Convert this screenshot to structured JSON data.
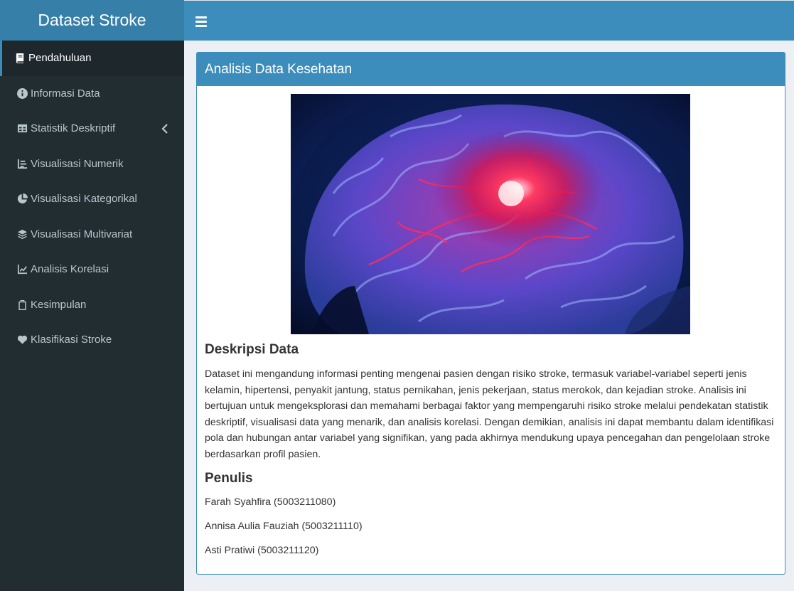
{
  "app": {
    "brand": "Dataset Stroke",
    "toggle_icon": "hamburger-icon"
  },
  "sidebar": {
    "items": [
      {
        "label": "Pendahuluan",
        "icon": "book-icon",
        "active": true
      },
      {
        "label": "Informasi Data",
        "icon": "info-circle-icon"
      },
      {
        "label": "Statistik Deskriptif",
        "icon": "table-icon",
        "has_submenu": true
      },
      {
        "label": "Visualisasi Numerik",
        "icon": "bar-chart-icon"
      },
      {
        "label": "Visualisasi Kategorikal",
        "icon": "pie-chart-icon"
      },
      {
        "label": "Visualisasi Multivariat",
        "icon": "layers-icon"
      },
      {
        "label": "Analisis Korelasi",
        "icon": "line-chart-icon"
      },
      {
        "label": "Kesimpulan",
        "icon": "clipboard-icon"
      },
      {
        "label": "Klasifikasi Stroke",
        "icon": "heartbeat-icon"
      }
    ]
  },
  "main": {
    "box_title": "Analisis Data Kesehatan",
    "image_alt": "brain-illustration",
    "description_title": "Deskripsi Data",
    "description_text": "Dataset ini mengandung informasi penting mengenai pasien dengan risiko stroke, termasuk variabel-variabel seperti jenis kelamin, hipertensi, penyakit jantung, status pernikahan, jenis pekerjaan, status merokok, dan kejadian stroke. Analisis ini bertujuan untuk mengeksplorasi dan memahami berbagai faktor yang mempengaruhi risiko stroke melalui pendekatan statistik deskriptif, visualisasi data yang menarik, dan analisis korelasi. Dengan demikian, analisis ini dapat membantu dalam identifikasi pola dan hubungan antar variabel yang signifikan, yang pada akhirnya mendukung upaya pencegahan dan pengelolaan stroke berdasarkan profil pasien.",
    "authors_title": "Penulis",
    "authors": [
      "Farah Syahfira (5003211080)",
      "Annisa Aulia Fauziah (5003211110)",
      "Asti Pratiwi (5003211120)"
    ]
  },
  "colors": {
    "header": "#3c8dbc",
    "brand_bg": "#367fa9",
    "sidebar_bg": "#222d32",
    "sidebar_active": "#1e282c",
    "sidebar_text": "#b8c7ce",
    "content_bg": "#ecf0f5"
  }
}
